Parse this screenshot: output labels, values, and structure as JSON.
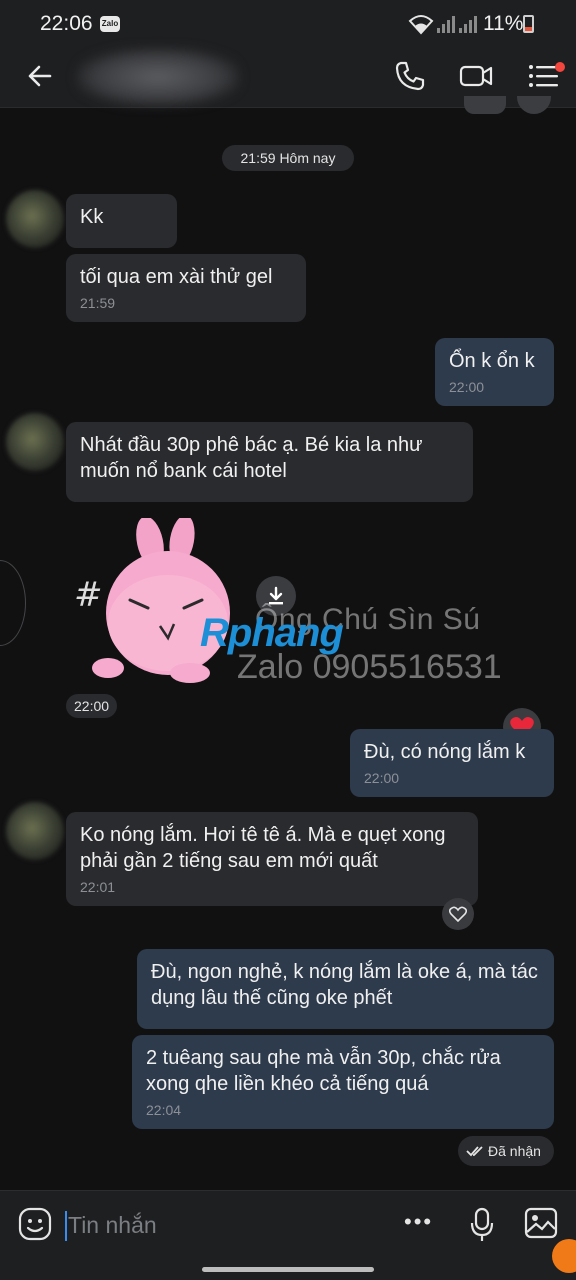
{
  "status_bar": {
    "time": "22:06",
    "app_badge": "Zalo",
    "battery": "11%"
  },
  "header": {
    "back_icon": "arrow-left-icon",
    "call_icon": "phone-icon",
    "video_icon": "video-camera-icon",
    "menu_icon": "list-menu-icon"
  },
  "date_divider": "21:59 Hôm nay",
  "messages": [
    {
      "dir": "in",
      "text": "Kk",
      "time": ""
    },
    {
      "dir": "in",
      "text": "tối qua em xài thử gel",
      "time": "21:59"
    },
    {
      "dir": "out",
      "text": "Ổn k ổn k",
      "time": "22:00"
    },
    {
      "dir": "in",
      "text": "Nhát đầu 30p phê bác ạ. Bé kia la như muốn nổ bank cái hotel",
      "time": ""
    },
    {
      "dir": "out",
      "text": "Đù, có nóng lắm k",
      "time": "22:00"
    },
    {
      "dir": "in",
      "text": "Ko nóng lắm. Hơi tê tê á. Mà e quẹt xong phải gần 2 tiếng sau em mới quất",
      "time": "22:01"
    },
    {
      "dir": "out",
      "text": "Đù, ngon nghẻ, k nóng lắm là oke á, mà tác dụng lâu thế cũng oke phết",
      "time": ""
    },
    {
      "dir": "out",
      "text": "2 tuêang sau qhe mà vẫn 30p, chắc rửa xong qhe liền khéo cả tiếng quá",
      "time": "22:04"
    }
  ],
  "sticker": {
    "time": "22:00",
    "watermark_name": "Ông Chú Sìn Sú",
    "watermark_logo": "Rphang",
    "watermark_phone": "Zalo 0905516531"
  },
  "status": {
    "delivered": "Đã nhận"
  },
  "input": {
    "placeholder": "Tin nhắn",
    "more_label": "•••"
  },
  "colors": {
    "incoming_bubble": "#2a2b2e",
    "outgoing_bubble": "#2e3b4c",
    "background": "#111112",
    "accent": "#3b8cf0"
  }
}
